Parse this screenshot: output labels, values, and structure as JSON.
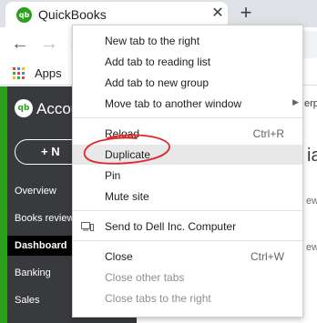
{
  "tab": {
    "favicon": "qb",
    "title": "QuickBooks",
    "close_icon": "close-icon"
  },
  "newtab": {
    "icon": "plus-icon"
  },
  "toolbar": {
    "back_icon": "arrow-left-icon",
    "forward_icon": "arrow-right-icon",
    "omnibox_fragment": "ag"
  },
  "bookmarks": {
    "apps_label": "Apps"
  },
  "qb": {
    "logo": "qb",
    "brand": "Accou",
    "new_button": "+ N",
    "nav": [
      "Overview",
      "Books review",
      "Dashboard",
      "Banking",
      "Sales"
    ],
    "active_index": 2
  },
  "content_peek": [
    "erp",
    "ia",
    "ew",
    "ew"
  ],
  "menu": {
    "items": [
      {
        "label": "New tab to the right",
        "shortcut": "",
        "submenu": false,
        "disabled": false
      },
      {
        "label": "Add tab to reading list",
        "shortcut": "",
        "submenu": false,
        "disabled": false
      },
      {
        "label": "Add tab to new group",
        "shortcut": "",
        "submenu": false,
        "disabled": false
      },
      {
        "label": "Move tab to another window",
        "shortcut": "",
        "submenu": true,
        "disabled": false
      },
      {
        "label": "Reload",
        "shortcut": "Ctrl+R",
        "submenu": false,
        "disabled": false
      },
      {
        "label": "Duplicate",
        "shortcut": "",
        "submenu": false,
        "disabled": false,
        "highlighted": true
      },
      {
        "label": "Pin",
        "shortcut": "",
        "submenu": false,
        "disabled": false
      },
      {
        "label": "Mute site",
        "shortcut": "",
        "submenu": false,
        "disabled": false
      },
      {
        "label": "Send to Dell Inc. Computer",
        "shortcut": "",
        "submenu": false,
        "disabled": false,
        "icon": "cast-device-icon"
      },
      {
        "label": "Close",
        "shortcut": "Ctrl+W",
        "submenu": false,
        "disabled": false
      },
      {
        "label": "Close other tabs",
        "shortcut": "",
        "submenu": false,
        "disabled": true
      },
      {
        "label": "Close tabs to the right",
        "shortcut": "",
        "submenu": false,
        "disabled": true
      }
    ]
  },
  "colors": {
    "qb_green": "#2ca01c",
    "annotation_red": "#e0262a",
    "sidebar": "#393a3d"
  }
}
